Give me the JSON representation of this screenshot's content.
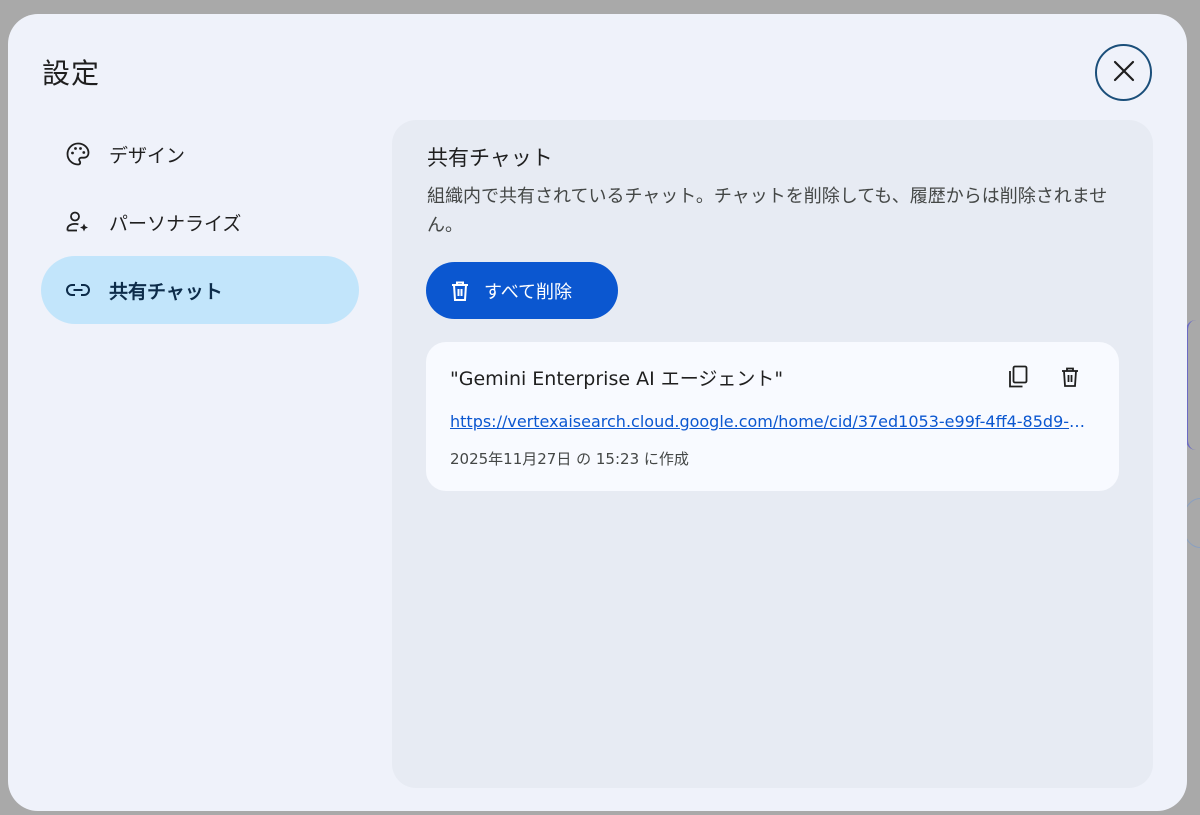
{
  "dialog": {
    "title": "設定",
    "close_icon": "close-icon"
  },
  "nav": {
    "items": [
      {
        "label": "デザイン",
        "icon": "palette-icon",
        "active": false
      },
      {
        "label": "パーソナライズ",
        "icon": "person-sparkle-icon",
        "active": false
      },
      {
        "label": "共有チャット",
        "icon": "link-icon",
        "active": true
      }
    ]
  },
  "panel": {
    "title": "共有チャット",
    "description": "組織内で共有されているチャット。チャットを削除しても、履歴からは削除されません。",
    "delete_all_label": "すべて削除",
    "delete_all_icon": "trash-icon"
  },
  "chats": [
    {
      "title": "\"Gemini Enterprise AI エージェント\"",
      "link": "https://vertexaisearch.cloud.google.com/home/cid/37ed1053-e99f-4ff4-85d9-5...",
      "meta": "2025年11月27日 の 15:23 に作成",
      "copy_icon": "copy-icon",
      "delete_icon": "trash-icon"
    }
  ],
  "colors": {
    "accent": "#0b57d0",
    "active_nav": "#c2e5fb",
    "panel_bg": "#e7ebf3",
    "dialog_bg": "#eff2fa"
  }
}
